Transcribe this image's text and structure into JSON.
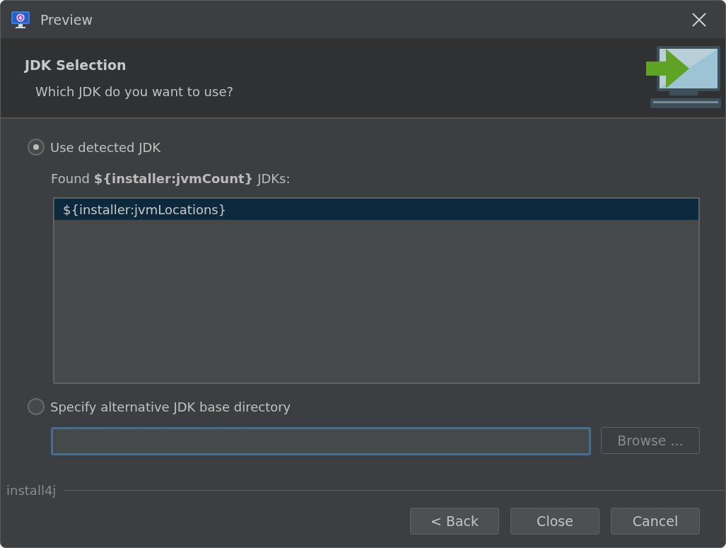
{
  "window": {
    "title": "Preview"
  },
  "header": {
    "title": "JDK Selection",
    "subtitle": "Which JDK do you want to use?"
  },
  "detected": {
    "label": "Use detected JDK",
    "selected": true,
    "found": "Found **${installer:jvmCount}** JDKs:",
    "jdks": [
      {
        "text": "${installer:jvmLocations}",
        "selected": true
      }
    ]
  },
  "alternative": {
    "label": "Specify alternative JDK base directory",
    "selected": false,
    "browse": {
      "label": "Browse ...",
      "disabled": true
    }
  },
  "brand": "install4j",
  "buttons": [
    {
      "label": "< Back"
    },
    {
      "label": "Close"
    },
    {
      "label": "Cancel"
    }
  ]
}
